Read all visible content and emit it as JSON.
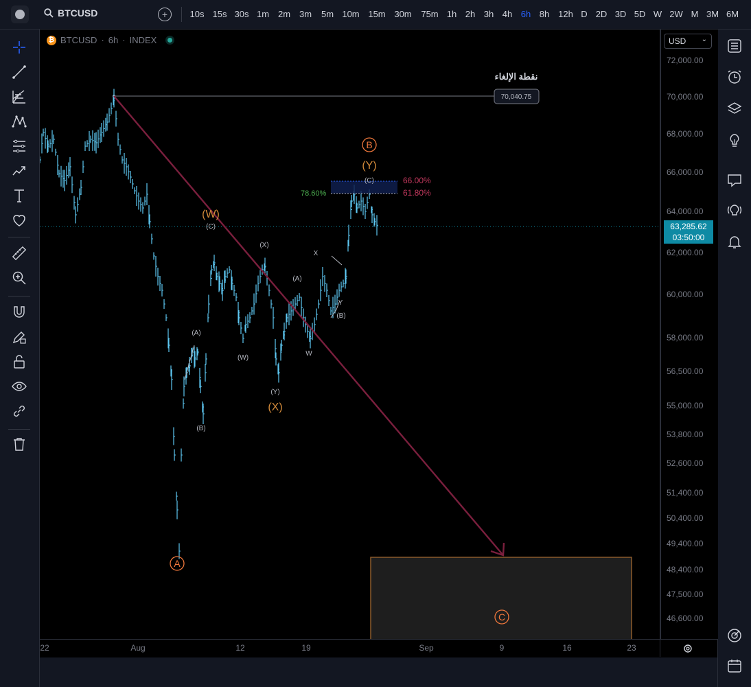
{
  "topbar": {
    "symbol": "BTCUSD",
    "intervals": [
      "10s",
      "15s",
      "30s",
      "1m",
      "2m",
      "3m",
      "5m",
      "10m",
      "15m",
      "30m",
      "75m",
      "1h",
      "2h",
      "3h",
      "4h",
      "6h",
      "8h",
      "12h",
      "D",
      "2D",
      "3D",
      "5D",
      "W",
      "2W",
      "M",
      "3M",
      "6M"
    ],
    "active_interval": "6h"
  },
  "legend": {
    "btc_glyph": "₿",
    "symbol": "BTCUSD",
    "dot1": "·",
    "interval": "6h",
    "dot2": "·",
    "exchange": "INDEX"
  },
  "price_axis": {
    "currency": "USD",
    "labels": [
      "72,000.00",
      "70,000.00",
      "68,000.00",
      "66,000.00",
      "64,000.00",
      "62,000.00",
      "60,000.00",
      "58,000.00",
      "56,500.00",
      "55,000.00",
      "53,800.00",
      "52,600.00",
      "51,400.00",
      "50,400.00",
      "49,400.00",
      "48,400.00",
      "47,500.00",
      "46,600.00"
    ],
    "current_price": "63,285.62",
    "countdown": "03:50:00"
  },
  "time_axis": {
    "labels": [
      "22",
      "Aug",
      "12",
      "19",
      "Sep",
      "9",
      "16",
      "23"
    ]
  },
  "annotations": {
    "invalidation_label": "نقطة الإلغاء",
    "invalidation_price": "70,040.75",
    "fib_left": "78.60%",
    "fib_66": "66.00%",
    "fib_618": "61.80%",
    "wave_A": "A",
    "wave_B": "B",
    "wave_C": "C",
    "wave_W": "(W)",
    "wave_X": "(X)",
    "wave_Y": "(Y)",
    "sub_C_w": "(C)",
    "sub_A_w": "(A)",
    "sub_B_w": "(B)",
    "sub_W_x": "(W)",
    "sub_X_x": "(X)",
    "sub_Y_x": "(Y)",
    "sub_W_small": "W",
    "sub_X_small": "X",
    "sub_Y_small": "Y",
    "sub_A_y": "(A)",
    "sub_B_y": "(B)",
    "sub_C_y": "(C)"
  },
  "colors": {
    "background": "#000000",
    "candle": "#5ec8f2",
    "trendline": "#7a1f3d",
    "orange_label": "#f0783c",
    "wave_gold": "#d38a3a",
    "fib_green": "#4caf50",
    "fib_red": "#c2385d",
    "price_tag": "#0e8aa4",
    "active_interval": "#2962ff"
  },
  "tools_left": [
    "crosshair-icon",
    "trend-line-icon",
    "fib-icon",
    "pattern-icon",
    "projection-icon",
    "prediction-icon",
    "text-icon",
    "heart-icon",
    "ruler-icon",
    "zoom-in-icon",
    "magnet-icon",
    "lock-drawing-icon",
    "lock-icon",
    "eye-icon",
    "link-icon",
    "trash-icon"
  ],
  "tools_right": [
    "watchlist-icon",
    "alarm-clock-icon",
    "layers-icon",
    "idea-icon",
    "chat-icon",
    "signal-icon",
    "bell-icon",
    "target-icon",
    "calendar-icon"
  ]
}
